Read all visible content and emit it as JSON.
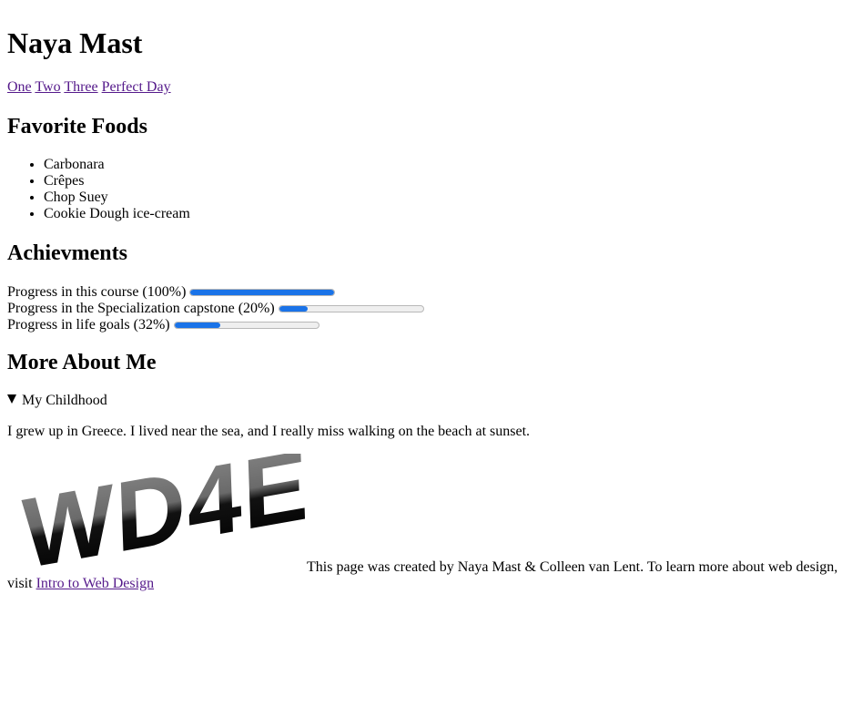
{
  "header": {
    "title": "Naya Mast"
  },
  "nav": {
    "links": [
      "One",
      "Two",
      "Three",
      "Perfect Day"
    ]
  },
  "foods": {
    "heading": "Favorite Foods",
    "items": [
      "Carbonara",
      "Crêpes",
      "Chop Suey",
      "Cookie Dough ice-cream"
    ]
  },
  "achievements": {
    "heading": "Achievments",
    "items": [
      {
        "label": "Progress in this course (100%)",
        "value": 1.0
      },
      {
        "label": "Progress in the Specialization capstone (20%)",
        "value": 0.2
      },
      {
        "label": "Progress in life goals (32%)",
        "value": 0.32
      }
    ]
  },
  "more": {
    "heading": "More About Me",
    "summary": "My Childhood",
    "body": "I grew up in Greece. I lived near the sea, and I really miss walking on the beach at sunset."
  },
  "footer": {
    "logo_text": "WD4E",
    "text_line_1": "This page was created by Naya Mast & Colleen van Lent. To learn more about web design,",
    "text_prefix": "visit",
    "link_text": "Intro to Web Design"
  },
  "colors": {
    "progress_fill": "#1a73e8",
    "link_visited": "#551a8b"
  }
}
